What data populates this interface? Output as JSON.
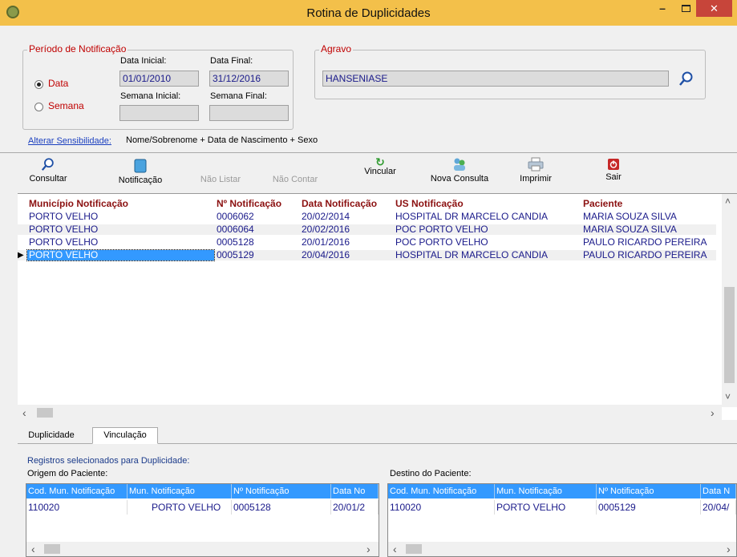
{
  "window": {
    "title": "Rotina de Duplicidades"
  },
  "periodo": {
    "group_title": "Período de Notificação",
    "radio_data": "Data",
    "radio_semana": "Semana",
    "data_inicial_label": "Data Inicial:",
    "data_final_label": "Data Final:",
    "data_inicial": "01/01/2010",
    "data_final": "31/12/2016",
    "semana_inicial_label": "Semana Inicial:",
    "semana_final_label": "Semana Final:"
  },
  "agravo": {
    "group_title": "Agravo",
    "value": "HANSENIASE"
  },
  "sensibilidade": {
    "link": "Alterar Sensibilidade:",
    "value": "Nome/Sobrenome + Data de Nascimento + Sexo"
  },
  "toolbar": {
    "consultar": "Consultar",
    "notificacao": "Notificação",
    "nao_listar": "Não Listar",
    "nao_contar": "Não Contar",
    "vincular": "Vincular",
    "nova_consulta": "Nova Consulta",
    "imprimir": "Imprimir",
    "sair": "Sair"
  },
  "grid": {
    "headers": [
      "Município Notificação",
      "Nº Notificação",
      "Data Notificação",
      "US Notificação",
      "Paciente"
    ],
    "rows": [
      [
        "PORTO VELHO",
        "0006062",
        "20/02/2014",
        "HOSPITAL DR MARCELO CANDIA",
        "MARIA SOUZA SILVA"
      ],
      [
        "PORTO VELHO",
        "0006064",
        "20/02/2016",
        "POC PORTO VELHO",
        "MARIA SOUZA SILVA"
      ],
      [
        "PORTO VELHO",
        "0005128",
        "20/01/2016",
        "POC PORTO VELHO",
        "PAULO RICARDO PEREIRA"
      ],
      [
        "PORTO VELHO",
        "0005129",
        "20/04/2016",
        "HOSPITAL DR MARCELO CANDIA",
        "PAULO RICARDO PEREIRA"
      ]
    ]
  },
  "tabs": {
    "duplicidade": "Duplicidade",
    "vinculacao": "Vinculação"
  },
  "bottom": {
    "registros_label": "Registros selecionados para Duplicidade:",
    "origem_label": "Origem do Paciente:",
    "destino_label": "Destino do Paciente:",
    "origem_headers": [
      "Cod. Mun. Notificação",
      "Mun. Notificação",
      "Nº Notificação",
      "Data No"
    ],
    "origem_row": [
      "110020",
      "PORTO VELHO",
      "0005128",
      "20/01/2"
    ],
    "destino_headers": [
      "Cod. Mun. Notificação",
      "Mun. Notificação",
      "Nº Notificação",
      "Data N"
    ],
    "destino_row": [
      "110020",
      "PORTO VELHO",
      "0005129",
      "20/04/"
    ]
  }
}
